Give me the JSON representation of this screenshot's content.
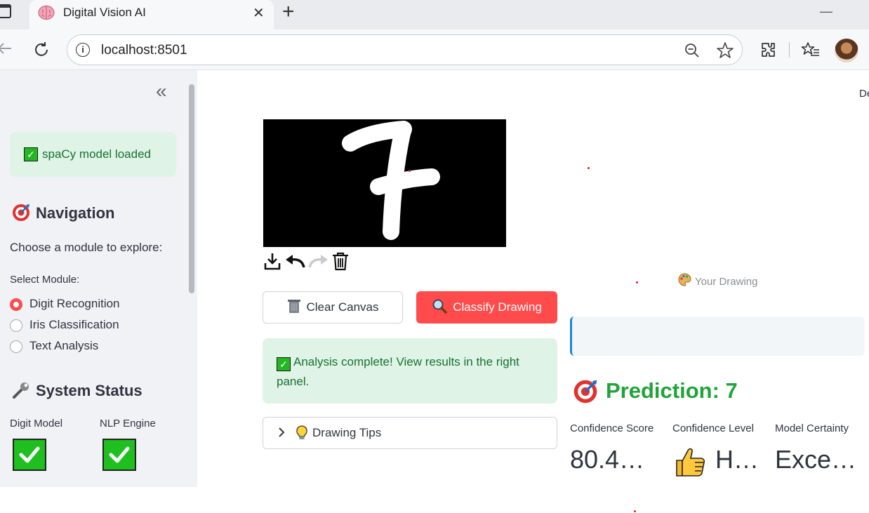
{
  "browser": {
    "tab_title": "Digital Vision AI",
    "url": "localhost:8501",
    "new_tab_symbol": "+",
    "minimize_symbol": "—"
  },
  "sidebar": {
    "collapse_symbol": "«",
    "model_status": "spaCy model loaded",
    "nav_title": "Navigation",
    "nav_subtitle": "Choose a module to explore:",
    "select_label": "Select Module:",
    "modules": [
      {
        "label": "Digit Recognition",
        "selected": true
      },
      {
        "label": "Iris Classification",
        "selected": false
      },
      {
        "label": "Text Analysis",
        "selected": false
      }
    ],
    "status_title": "System Status",
    "status_items": [
      {
        "label": "Digit Model"
      },
      {
        "label": "NLP Engine"
      }
    ]
  },
  "main": {
    "header_cut_text": "De",
    "canvas_digit": "7",
    "clear_button": "Clear Canvas",
    "classify_button": "Classify Drawing",
    "success_message": "Analysis complete! View results in the right panel.",
    "tips_label": "Drawing Tips",
    "your_drawing_caption": "Your Drawing",
    "prediction_title": "Prediction: 7",
    "metrics": [
      {
        "label": "Confidence Score",
        "value": "80.4…"
      },
      {
        "label": "Confidence Level",
        "value": "H…"
      },
      {
        "label": "Model Certainty",
        "value": "Exce…"
      }
    ]
  },
  "colors": {
    "accent_red": "#ff4b4b",
    "success_green": "#177233",
    "success_bg": "#dff3e6",
    "prediction_green": "#21a33c",
    "info_border": "#1c83e1"
  }
}
